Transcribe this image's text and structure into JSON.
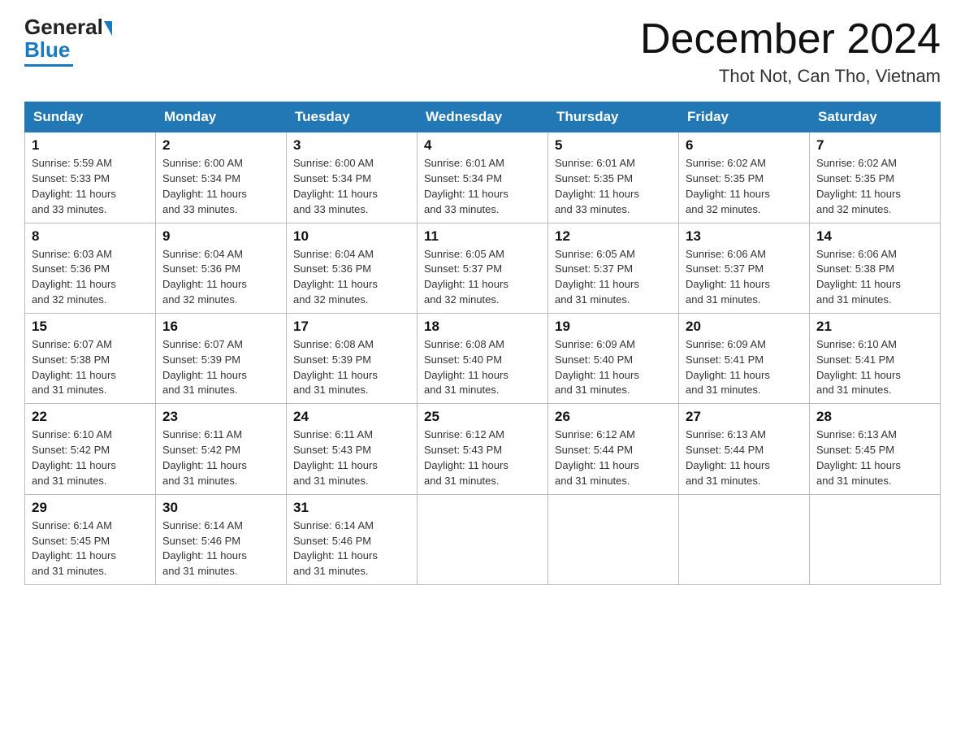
{
  "header": {
    "logo_general": "General",
    "logo_blue": "Blue",
    "month_title": "December 2024",
    "location": "Thot Not, Can Tho, Vietnam"
  },
  "days_of_week": [
    "Sunday",
    "Monday",
    "Tuesday",
    "Wednesday",
    "Thursday",
    "Friday",
    "Saturday"
  ],
  "weeks": [
    [
      {
        "day": "1",
        "sunrise": "5:59 AM",
        "sunset": "5:33 PM",
        "daylight": "11 hours and 33 minutes."
      },
      {
        "day": "2",
        "sunrise": "6:00 AM",
        "sunset": "5:34 PM",
        "daylight": "11 hours and 33 minutes."
      },
      {
        "day": "3",
        "sunrise": "6:00 AM",
        "sunset": "5:34 PM",
        "daylight": "11 hours and 33 minutes."
      },
      {
        "day": "4",
        "sunrise": "6:01 AM",
        "sunset": "5:34 PM",
        "daylight": "11 hours and 33 minutes."
      },
      {
        "day": "5",
        "sunrise": "6:01 AM",
        "sunset": "5:35 PM",
        "daylight": "11 hours and 33 minutes."
      },
      {
        "day": "6",
        "sunrise": "6:02 AM",
        "sunset": "5:35 PM",
        "daylight": "11 hours and 32 minutes."
      },
      {
        "day": "7",
        "sunrise": "6:02 AM",
        "sunset": "5:35 PM",
        "daylight": "11 hours and 32 minutes."
      }
    ],
    [
      {
        "day": "8",
        "sunrise": "6:03 AM",
        "sunset": "5:36 PM",
        "daylight": "11 hours and 32 minutes."
      },
      {
        "day": "9",
        "sunrise": "6:04 AM",
        "sunset": "5:36 PM",
        "daylight": "11 hours and 32 minutes."
      },
      {
        "day": "10",
        "sunrise": "6:04 AM",
        "sunset": "5:36 PM",
        "daylight": "11 hours and 32 minutes."
      },
      {
        "day": "11",
        "sunrise": "6:05 AM",
        "sunset": "5:37 PM",
        "daylight": "11 hours and 32 minutes."
      },
      {
        "day": "12",
        "sunrise": "6:05 AM",
        "sunset": "5:37 PM",
        "daylight": "11 hours and 31 minutes."
      },
      {
        "day": "13",
        "sunrise": "6:06 AM",
        "sunset": "5:37 PM",
        "daylight": "11 hours and 31 minutes."
      },
      {
        "day": "14",
        "sunrise": "6:06 AM",
        "sunset": "5:38 PM",
        "daylight": "11 hours and 31 minutes."
      }
    ],
    [
      {
        "day": "15",
        "sunrise": "6:07 AM",
        "sunset": "5:38 PM",
        "daylight": "11 hours and 31 minutes."
      },
      {
        "day": "16",
        "sunrise": "6:07 AM",
        "sunset": "5:39 PM",
        "daylight": "11 hours and 31 minutes."
      },
      {
        "day": "17",
        "sunrise": "6:08 AM",
        "sunset": "5:39 PM",
        "daylight": "11 hours and 31 minutes."
      },
      {
        "day": "18",
        "sunrise": "6:08 AM",
        "sunset": "5:40 PM",
        "daylight": "11 hours and 31 minutes."
      },
      {
        "day": "19",
        "sunrise": "6:09 AM",
        "sunset": "5:40 PM",
        "daylight": "11 hours and 31 minutes."
      },
      {
        "day": "20",
        "sunrise": "6:09 AM",
        "sunset": "5:41 PM",
        "daylight": "11 hours and 31 minutes."
      },
      {
        "day": "21",
        "sunrise": "6:10 AM",
        "sunset": "5:41 PM",
        "daylight": "11 hours and 31 minutes."
      }
    ],
    [
      {
        "day": "22",
        "sunrise": "6:10 AM",
        "sunset": "5:42 PM",
        "daylight": "11 hours and 31 minutes."
      },
      {
        "day": "23",
        "sunrise": "6:11 AM",
        "sunset": "5:42 PM",
        "daylight": "11 hours and 31 minutes."
      },
      {
        "day": "24",
        "sunrise": "6:11 AM",
        "sunset": "5:43 PM",
        "daylight": "11 hours and 31 minutes."
      },
      {
        "day": "25",
        "sunrise": "6:12 AM",
        "sunset": "5:43 PM",
        "daylight": "11 hours and 31 minutes."
      },
      {
        "day": "26",
        "sunrise": "6:12 AM",
        "sunset": "5:44 PM",
        "daylight": "11 hours and 31 minutes."
      },
      {
        "day": "27",
        "sunrise": "6:13 AM",
        "sunset": "5:44 PM",
        "daylight": "11 hours and 31 minutes."
      },
      {
        "day": "28",
        "sunrise": "6:13 AM",
        "sunset": "5:45 PM",
        "daylight": "11 hours and 31 minutes."
      }
    ],
    [
      {
        "day": "29",
        "sunrise": "6:14 AM",
        "sunset": "5:45 PM",
        "daylight": "11 hours and 31 minutes."
      },
      {
        "day": "30",
        "sunrise": "6:14 AM",
        "sunset": "5:46 PM",
        "daylight": "11 hours and 31 minutes."
      },
      {
        "day": "31",
        "sunrise": "6:14 AM",
        "sunset": "5:46 PM",
        "daylight": "11 hours and 31 minutes."
      },
      null,
      null,
      null,
      null
    ]
  ]
}
